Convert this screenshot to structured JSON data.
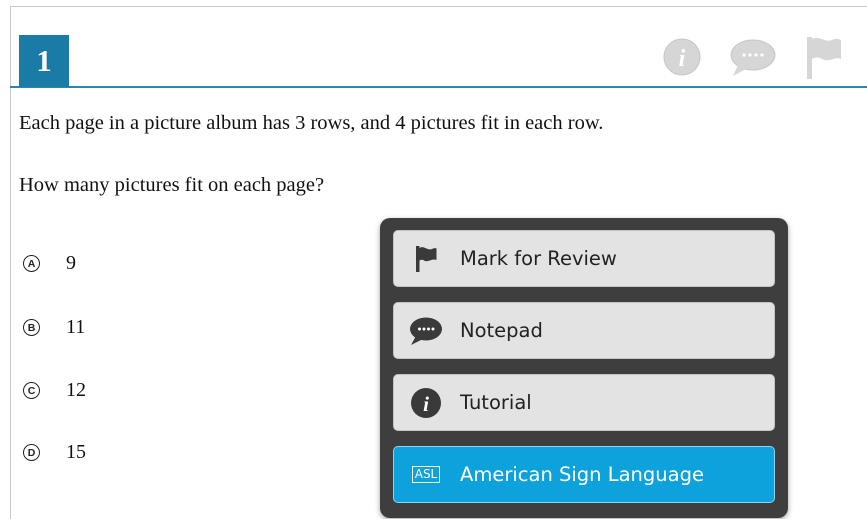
{
  "question": {
    "number": "1",
    "line1": "Each page in a picture album has 3 rows, and 4 pictures fit in each row.",
    "line2": "How many pictures fit on each page?"
  },
  "header_icons": [
    "info-icon",
    "comment-icon",
    "flag-icon"
  ],
  "options": [
    {
      "letter": "A",
      "value": "9"
    },
    {
      "letter": "B",
      "value": "11"
    },
    {
      "letter": "C",
      "value": "12"
    },
    {
      "letter": "D",
      "value": "15"
    }
  ],
  "menu": {
    "items": [
      {
        "label": "Mark for Review",
        "icon": "flag-icon"
      },
      {
        "label": "Notepad",
        "icon": "comment-icon"
      },
      {
        "label": "Tutorial",
        "icon": "info-icon"
      },
      {
        "label": "American Sign Language",
        "icon": "asl-icon",
        "icon_text": "ASL",
        "active": true
      }
    ]
  },
  "colors": {
    "accent": "#1a7ba6",
    "menu_bg": "#3e3e3e",
    "menu_active": "#0ea2dc"
  }
}
